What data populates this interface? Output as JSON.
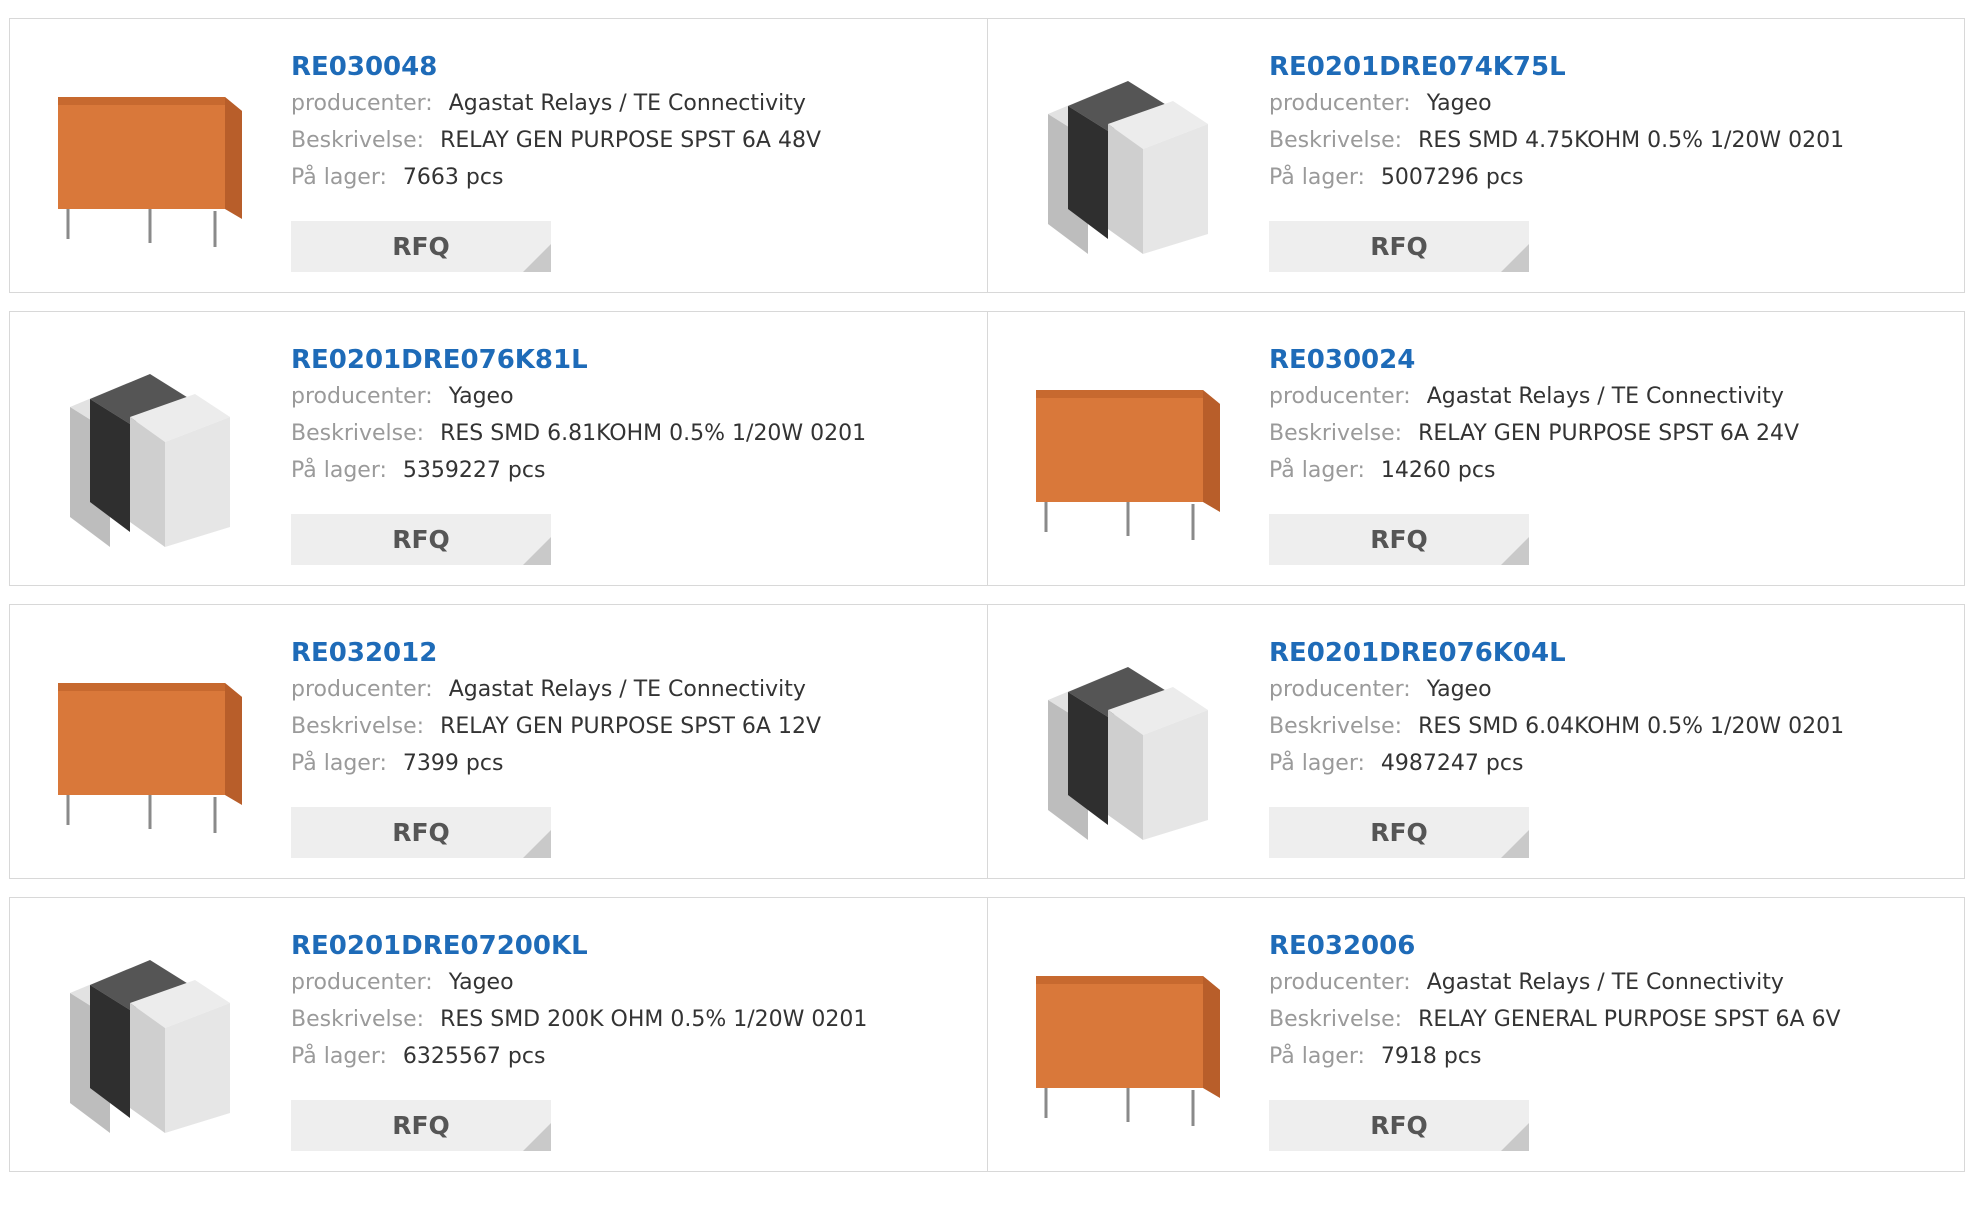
{
  "labels": {
    "manufacturer": "producenter:",
    "description": "Beskrivelse:",
    "stock": "På lager:",
    "rfq": "RFQ"
  },
  "colors": {
    "part_link": "#1e6bb8",
    "relay_body": "#d9783a",
    "resistor_end": "#d9d9d9",
    "resistor_band": "#333333"
  },
  "products": [
    {
      "part": "RE030048",
      "manufacturer": "Agastat Relays / TE Connectivity",
      "description": "RELAY GEN PURPOSE SPST 6A 48V",
      "stock": "7663 pcs",
      "image": "relay-image"
    },
    {
      "part": "RE0201DRE074K75L",
      "manufacturer": "Yageo",
      "description": "RES SMD 4.75KOHM 0.5% 1/20W 0201",
      "stock": "5007296 pcs",
      "image": "resistor-image"
    },
    {
      "part": "RE0201DRE076K81L",
      "manufacturer": "Yageo",
      "description": "RES SMD 6.81KOHM 0.5% 1/20W 0201",
      "stock": "5359227 pcs",
      "image": "resistor-image"
    },
    {
      "part": "RE030024",
      "manufacturer": "Agastat Relays / TE Connectivity",
      "description": "RELAY GEN PURPOSE SPST 6A 24V",
      "stock": "14260 pcs",
      "image": "relay-image"
    },
    {
      "part": "RE032012",
      "manufacturer": "Agastat Relays / TE Connectivity",
      "description": "RELAY GEN PURPOSE SPST 6A 12V",
      "stock": "7399 pcs",
      "image": "relay-image"
    },
    {
      "part": "RE0201DRE076K04L",
      "manufacturer": "Yageo",
      "description": "RES SMD 6.04KOHM 0.5% 1/20W 0201",
      "stock": "4987247 pcs",
      "image": "resistor-image"
    },
    {
      "part": "RE0201DRE07200KL",
      "manufacturer": "Yageo",
      "description": "RES SMD 200K OHM 0.5% 1/20W 0201",
      "stock": "6325567 pcs",
      "image": "resistor-image"
    },
    {
      "part": "RE032006",
      "manufacturer": "Agastat Relays / TE Connectivity",
      "description": "RELAY GENERAL PURPOSE SPST 6A 6V",
      "stock": "7918 pcs",
      "image": "relay-image"
    }
  ]
}
